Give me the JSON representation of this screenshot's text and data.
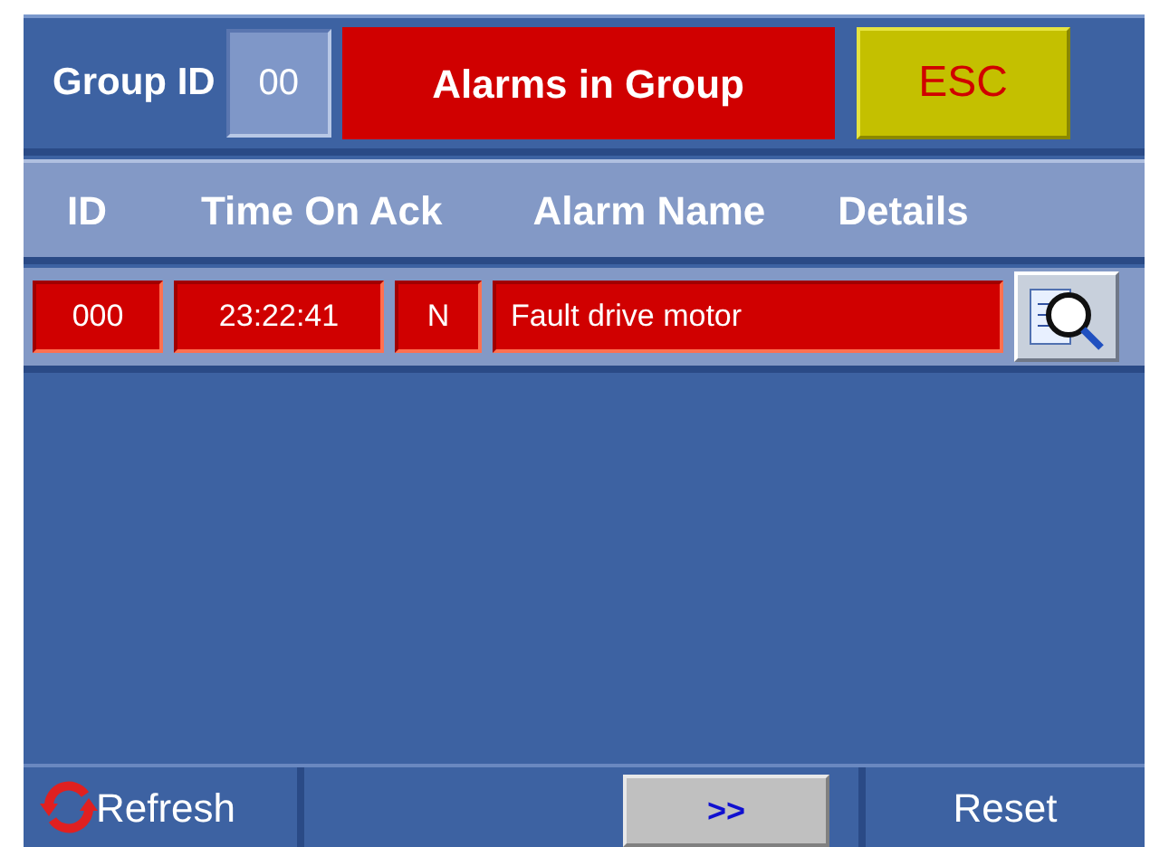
{
  "header": {
    "group_label": "Group ID",
    "group_id": "00",
    "title": "Alarms in Group",
    "esc": "ESC"
  },
  "columns": [
    "ID",
    "Time On Ack",
    "Alarm Name",
    "Details"
  ],
  "rows": [
    {
      "id": "000",
      "time": "23:22:41",
      "ack": "N",
      "name": "Fault drive motor"
    }
  ],
  "footer": {
    "refresh": "Refresh",
    "next": ">>",
    "reset": "Reset"
  }
}
